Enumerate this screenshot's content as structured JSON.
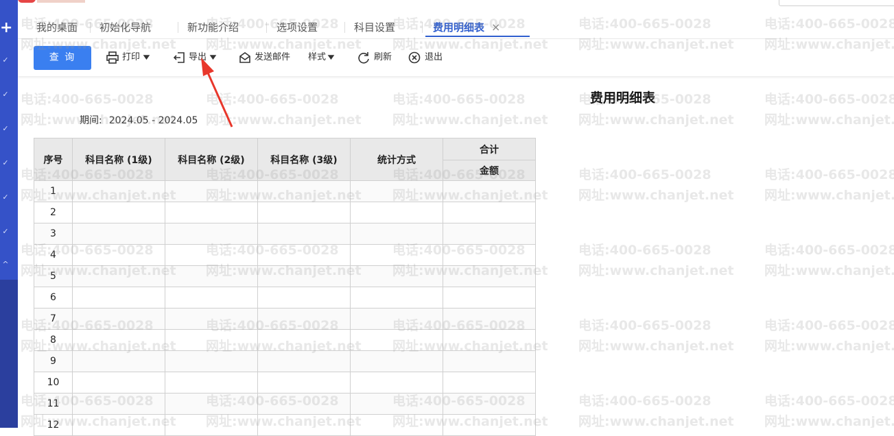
{
  "nav": {
    "plus_glyph": "+",
    "chevron_glyphs": [
      "✓",
      "✓",
      "✓",
      "✓",
      "✓",
      "✓"
    ],
    "collapse_glyph": "^"
  },
  "tabs": [
    {
      "label": "我的桌面"
    },
    {
      "label": "初始化导航"
    },
    {
      "label": "新功能介绍"
    },
    {
      "label": "选项设置"
    },
    {
      "label": "科目设置"
    },
    {
      "label": "费用明细表",
      "active": true
    }
  ],
  "tab_close_glyph": "×",
  "toolbar": {
    "query_label": "查 询",
    "print_label": "打印",
    "export_label": "导出",
    "send_mail_label": "发送邮件",
    "style_label": "样式",
    "refresh_label": "刷新",
    "exit_label": "退出"
  },
  "report": {
    "title": "费用明细表",
    "period_label": "期间:",
    "period_value": "2024.05 - 2024.05"
  },
  "table": {
    "headers": {
      "seq": "序号",
      "account1": "科目名称 (1级)",
      "account2": "科目名称 (2级)",
      "account3": "科目名称 (3级)",
      "stat_method": "统计方式",
      "total": "合计",
      "amount": "金额"
    },
    "rows": [
      "1",
      "2",
      "3",
      "4",
      "5",
      "6",
      "7",
      "8",
      "9",
      "10",
      "11",
      "12"
    ]
  },
  "watermark": {
    "phone": "电话:400-665-0028",
    "site": "网址:www.chanjet.net"
  },
  "colors": {
    "accent": "#3a7ff0",
    "nav": "#3552c8",
    "active_tab": "#2f5ecf",
    "annotation_arrow": "#e8372b"
  }
}
